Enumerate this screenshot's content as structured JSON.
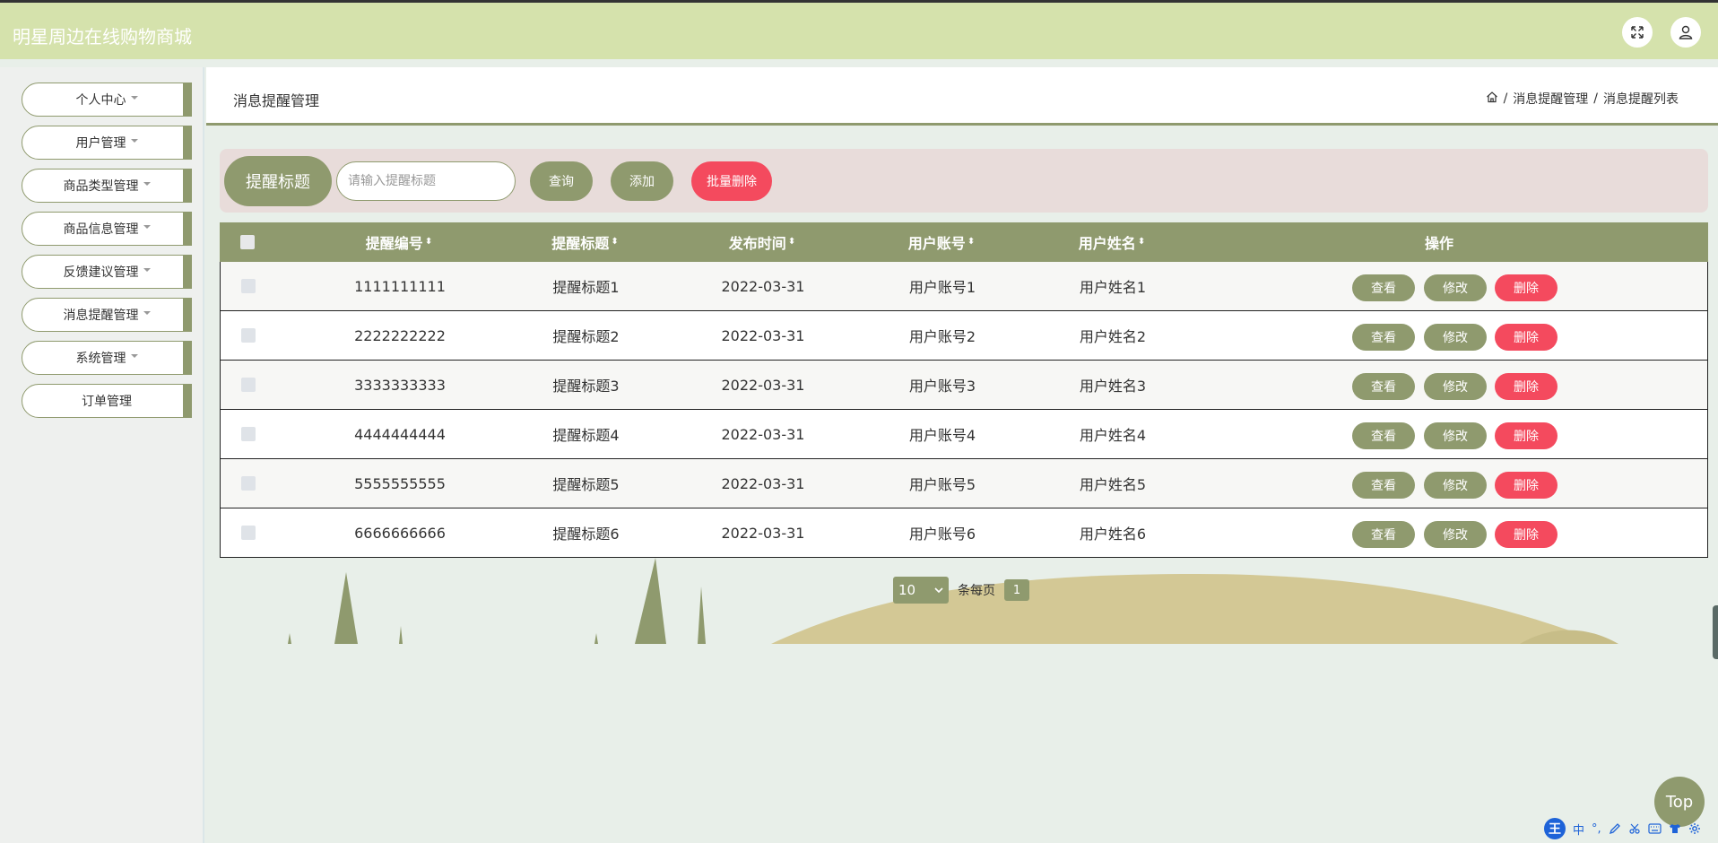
{
  "app": {
    "title": "明星周边在线购物商城"
  },
  "header": {
    "fullscreen_icon": "expand-icon",
    "user_icon": "user-icon"
  },
  "sidebar": {
    "items": [
      {
        "label": "个人中心",
        "dropdown": true
      },
      {
        "label": "用户管理",
        "dropdown": true
      },
      {
        "label": "商品类型管理",
        "dropdown": true
      },
      {
        "label": "商品信息管理",
        "dropdown": true
      },
      {
        "label": "反馈建议管理",
        "dropdown": true
      },
      {
        "label": "消息提醒管理",
        "dropdown": true
      },
      {
        "label": "系统管理",
        "dropdown": true
      },
      {
        "label": "订单管理",
        "dropdown": false
      }
    ]
  },
  "breadcrumb": {
    "page_title": "消息提醒管理",
    "home_icon": "home-icon",
    "sep": "/",
    "level1": "消息提醒管理",
    "level2": "消息提醒列表"
  },
  "search": {
    "label": "提醒标题",
    "placeholder": "请输入提醒标题",
    "query_button": "查询",
    "add_button": "添加",
    "batch_delete_button": "批量删除"
  },
  "table": {
    "columns": [
      "提醒编号",
      "提醒标题",
      "发布时间",
      "用户账号",
      "用户姓名",
      "操作"
    ],
    "rows": [
      {
        "id": "1111111111",
        "title": "提醒标题1",
        "time": "2022-03-31",
        "account": "用户账号1",
        "name": "用户姓名1"
      },
      {
        "id": "2222222222",
        "title": "提醒标题2",
        "time": "2022-03-31",
        "account": "用户账号2",
        "name": "用户姓名2"
      },
      {
        "id": "3333333333",
        "title": "提醒标题3",
        "time": "2022-03-31",
        "account": "用户账号3",
        "name": "用户姓名3"
      },
      {
        "id": "4444444444",
        "title": "提醒标题4",
        "time": "2022-03-31",
        "account": "用户账号4",
        "name": "用户姓名4"
      },
      {
        "id": "5555555555",
        "title": "提醒标题5",
        "time": "2022-03-31",
        "account": "用户账号5",
        "name": "用户姓名5"
      },
      {
        "id": "6666666666",
        "title": "提醒标题6",
        "time": "2022-03-31",
        "account": "用户账号6",
        "name": "用户姓名6"
      }
    ],
    "actions": {
      "view": "查看",
      "edit": "修改",
      "delete": "删除"
    }
  },
  "pagination": {
    "page_size": "10",
    "per_page_label": "条每页",
    "current_page": "1"
  },
  "back_to_top": "Top",
  "ime": {
    "logo": "王",
    "mode": "中",
    "punct": "°,",
    "icons": [
      "pen-icon",
      "scissors-icon",
      "keyboard-icon",
      "shirt-icon",
      "gear-icon"
    ]
  },
  "colors": {
    "accent": "#8f9a6e",
    "header_bg": "#d5e2ac",
    "danger": "#f44a5e",
    "search_panel": "#e8dcda",
    "page_bg": "#e8efe9"
  }
}
